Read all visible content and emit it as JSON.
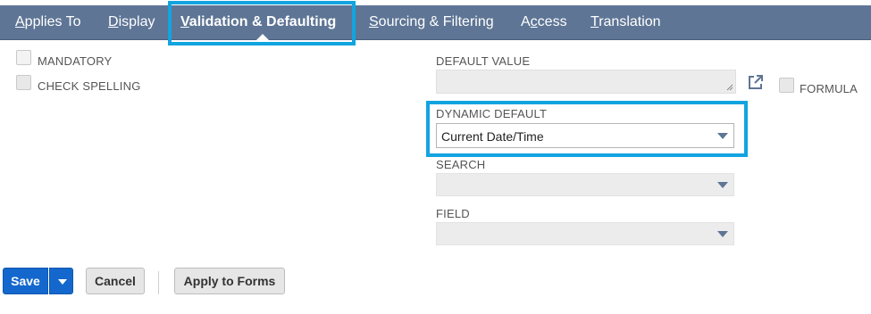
{
  "tabs": [
    {
      "first": "A",
      "rest": "pplies To"
    },
    {
      "first": "D",
      "rest": "isplay"
    },
    {
      "first": "V",
      "rest": "alidation & Defaulting"
    },
    {
      "first": "S",
      "rest": "ourcing & Filtering"
    },
    {
      "first": "A",
      "rest": "ccess",
      "prefix": ""
    },
    {
      "first": "T",
      "rest": "ranslation"
    }
  ],
  "access_tab": {
    "before": "A",
    "underlined": "c",
    "after": "cess"
  },
  "active_tab_index": 2,
  "checkboxes": {
    "mandatory": "MANDATORY",
    "check_spelling": "CHECK SPELLING",
    "formula": "FORMULA"
  },
  "fields": {
    "default_value_label": "DEFAULT VALUE",
    "dynamic_default_label": "DYNAMIC DEFAULT",
    "dynamic_default_value": "Current Date/Time",
    "search_label": "SEARCH",
    "field_label": "FIELD"
  },
  "buttons": {
    "save": "Save",
    "cancel": "Cancel",
    "apply_to_forms": "Apply to Forms"
  },
  "colors": {
    "tabbar": "#5e7595",
    "highlight": "#12a4e0",
    "primary_button": "#1467cc"
  },
  "icons": {
    "open_external": "external-link-icon",
    "save_menu": "caret-down-icon",
    "select_arrow": "caret-down-icon"
  }
}
